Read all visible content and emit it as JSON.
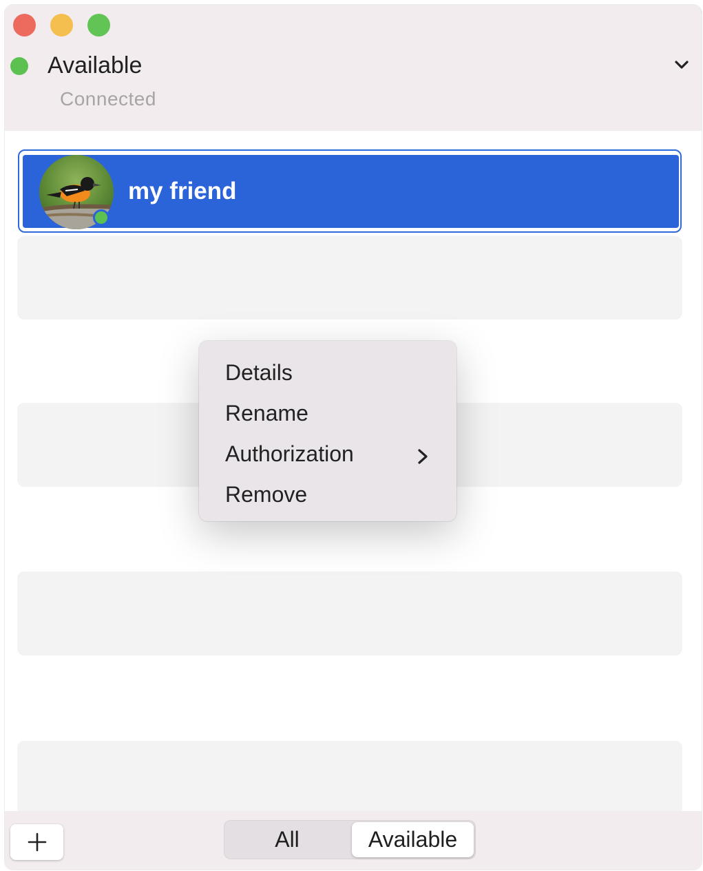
{
  "window": {
    "traffic_lights": [
      "close",
      "minimize",
      "zoom"
    ]
  },
  "header": {
    "status_label": "Available",
    "status_color": "#5dc152",
    "connection_text": "Connected",
    "dropdown_icon": "chevron-down-icon"
  },
  "contacts": {
    "selected": {
      "name": "my friend",
      "avatar": "bird-avatar",
      "presence": "online",
      "highlight_color": "#2b63d9"
    },
    "placeholder_rows": 4
  },
  "context_menu": {
    "items": [
      {
        "label": "Details"
      },
      {
        "label": "Rename"
      },
      {
        "label": "Authorization",
        "submenu_icon": "chevron-right-icon"
      },
      {
        "label": "Remove"
      }
    ]
  },
  "footer": {
    "add_icon": "plus-icon",
    "filter": {
      "options": [
        "All",
        "Available"
      ],
      "selected": "Available"
    }
  }
}
